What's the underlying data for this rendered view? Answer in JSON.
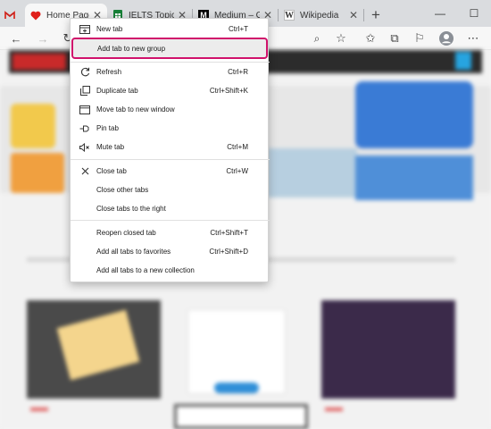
{
  "tabs": [
    {
      "title": "",
      "favicon": "M",
      "color": "#d93025",
      "pinned": true
    },
    {
      "title": "Home Page - L",
      "favicon": "heart",
      "color": "#e0201b",
      "active": true
    },
    {
      "title": "IELTS Topics - G",
      "favicon": "sheets",
      "color": "#188038"
    },
    {
      "title": "Medium – Get",
      "favicon": "M",
      "color": "#000000"
    },
    {
      "title": "Wikipedia",
      "favicon": "W",
      "color": "#000000"
    }
  ],
  "context_menu": {
    "items": [
      {
        "label": "New tab",
        "shortcut": "Ctrl+T",
        "icon": "new-tab-icon"
      },
      {
        "label": "Add tab to new group",
        "shortcut": "",
        "icon": "",
        "highlighted": true
      },
      {
        "label": "Refresh",
        "shortcut": "Ctrl+R",
        "icon": "refresh-icon"
      },
      {
        "label": "Duplicate tab",
        "shortcut": "Ctrl+Shift+K",
        "icon": "duplicate-icon"
      },
      {
        "label": "Move tab to new window",
        "shortcut": "",
        "icon": "window-icon"
      },
      {
        "label": "Pin tab",
        "shortcut": "",
        "icon": "pin-icon"
      },
      {
        "label": "Mute tab",
        "shortcut": "Ctrl+M",
        "icon": "mute-icon"
      },
      {
        "label": "Close tab",
        "shortcut": "Ctrl+W",
        "icon": "close-icon"
      },
      {
        "label": "Close other tabs",
        "shortcut": "",
        "icon": ""
      },
      {
        "label": "Close tabs to the right",
        "shortcut": "",
        "icon": ""
      },
      {
        "label": "Reopen closed tab",
        "shortcut": "Ctrl+Shift+T",
        "icon": ""
      },
      {
        "label": "Add all tabs to favorites",
        "shortcut": "Ctrl+Shift+D",
        "icon": ""
      },
      {
        "label": "Add all tabs to a new collection",
        "shortcut": "",
        "icon": ""
      }
    ]
  }
}
